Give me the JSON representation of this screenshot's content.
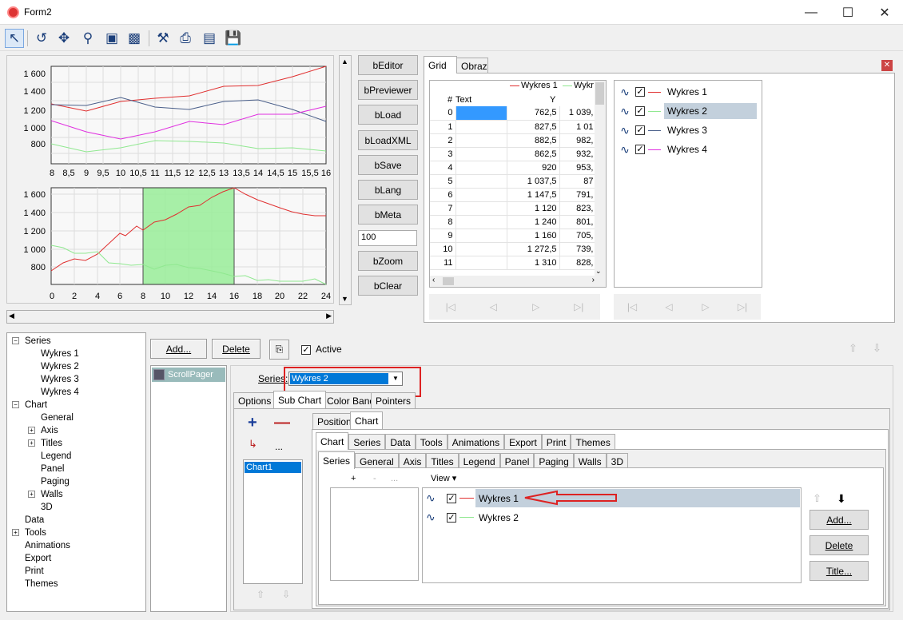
{
  "window": {
    "title": "Form2"
  },
  "toolbar": {
    "icons": [
      "pointer-icon",
      "rotate-icon",
      "move-icon",
      "zoom-icon",
      "depth-icon",
      "3d-icon",
      "edit-icon",
      "print-icon",
      "export-icon",
      "save-icon"
    ]
  },
  "chart1": {
    "yticks": [
      "1 600",
      "1 400",
      "1 200",
      "1 000",
      "800"
    ],
    "xticks": [
      "8",
      "8,5",
      "9",
      "9,5",
      "10",
      "10,5",
      "11",
      "11,5",
      "12",
      "12,5",
      "13",
      "13,5",
      "14",
      "14,5",
      "15",
      "15,5",
      "16"
    ]
  },
  "chart2": {
    "yticks": [
      "1 600",
      "1 400",
      "1 200",
      "1 000",
      "800"
    ],
    "xticks": [
      "0",
      "2",
      "4",
      "6",
      "8",
      "10",
      "12",
      "14",
      "16",
      "18",
      "20",
      "22",
      "24"
    ]
  },
  "buttons": {
    "editor": "bEditor",
    "previewer": "bPreviewer",
    "load": "bLoad",
    "loadxml": "bLoadXML",
    "save": "bSave",
    "lang": "bLang",
    "meta": "bMeta",
    "zoom_value": "100",
    "zoom": "bZoom",
    "clear": "bClear"
  },
  "gridpanel": {
    "tabs": [
      "Grid",
      "Obraz"
    ],
    "legend1": "Wykres 1",
    "legend2": "Wykr",
    "col_hash": "#",
    "col_text": "Text",
    "col_y": "Y",
    "rows": [
      [
        "0",
        "762,5",
        "1 039,"
      ],
      [
        "1",
        "827,5",
        "1 01"
      ],
      [
        "2",
        "882,5",
        "982,"
      ],
      [
        "3",
        "862,5",
        "932,"
      ],
      [
        "4",
        "920",
        "953,"
      ],
      [
        "5",
        "1 037,5",
        "87"
      ],
      [
        "6",
        "1 147,5",
        "791,"
      ],
      [
        "7",
        "1 120",
        "823,"
      ],
      [
        "8",
        "1 240",
        "801,"
      ],
      [
        "9",
        "1 160",
        "705,"
      ],
      [
        "10",
        "1 272,5",
        "739,"
      ],
      [
        "11",
        "1 310",
        "828,"
      ]
    ]
  },
  "legend": {
    "items": [
      {
        "name": "Wykres 1",
        "color": "#e03030"
      },
      {
        "name": "Wykres 2",
        "color": "#90e890"
      },
      {
        "name": "Wykres 3",
        "color": "#4a5f8a"
      },
      {
        "name": "Wykres 4",
        "color": "#e030e0"
      }
    ]
  },
  "tree": {
    "series": "Series",
    "w1": "Wykres 1",
    "w2": "Wykres 2",
    "w3": "Wykres 3",
    "w4": "Wykres 4",
    "chart": "Chart",
    "general": "General",
    "axis": "Axis",
    "titles": "Titles",
    "legend": "Legend",
    "panel": "Panel",
    "paging": "Paging",
    "walls": "Walls",
    "d3": "3D",
    "data": "Data",
    "tools": "Tools",
    "animations": "Animations",
    "export": "Export",
    "print": "Print",
    "themes": "Themes"
  },
  "editor": {
    "add": "Add...",
    "delete": "Delete",
    "active": "Active",
    "tool_item": "ScrollPager",
    "series_label": "Series:",
    "series_value": "Wykres 2",
    "tabs": [
      "Options",
      "Sub Chart",
      "Color Band",
      "Pointers"
    ],
    "chart_list_item": "Chart1",
    "inner_tabs": [
      "Position",
      "Chart"
    ],
    "chart_tabs": [
      "Chart",
      "Series",
      "Data",
      "Tools",
      "Animations",
      "Export",
      "Print",
      "Themes"
    ],
    "sub_tabs": [
      "Series",
      "General",
      "Axis",
      "Titles",
      "Legend",
      "Panel",
      "Paging",
      "Walls",
      "3D"
    ],
    "mini_plus": "+",
    "mini_minus": "-",
    "mini_dots": "...",
    "view": "View",
    "dots": "...",
    "series_items": [
      "Wykres 1",
      "Wykres 2"
    ],
    "add2": "Add...",
    "delete2": "Delete",
    "title": "Title..."
  }
}
